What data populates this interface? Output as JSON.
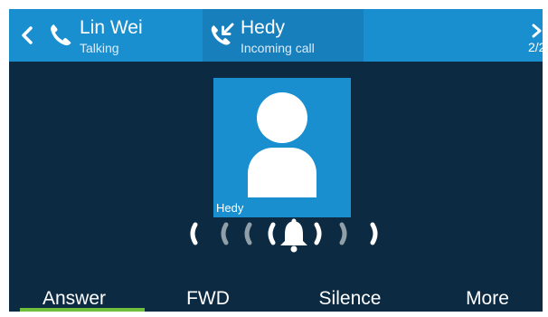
{
  "header": {
    "calls": [
      {
        "name": "Lin Wei",
        "status": "Talking",
        "icon": "phone-icon"
      },
      {
        "name": "Hedy",
        "status": "Incoming call",
        "icon": "incoming-call-icon"
      }
    ],
    "page_indicator": "2/2"
  },
  "contact": {
    "name": "Hedy",
    "icon": "person-icon"
  },
  "ringing_icon": "bell-icon",
  "softkeys": [
    {
      "label": "Answer"
    },
    {
      "label": "FWD"
    },
    {
      "label": "Silence"
    },
    {
      "label": "More"
    }
  ],
  "colors": {
    "background": "#0c2a42",
    "header": "#1a8fd0",
    "active_tab": "#187fbd",
    "accent_green": "#6fbf3c"
  }
}
